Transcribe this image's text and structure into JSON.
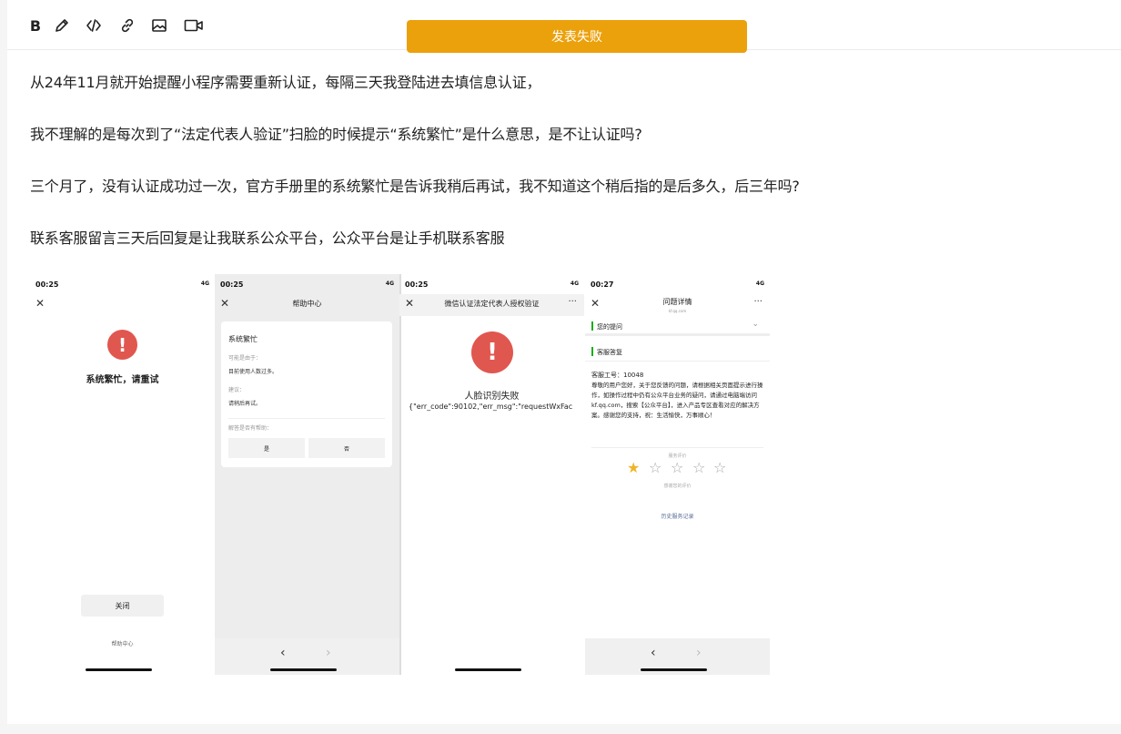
{
  "toolbar": {
    "bold_label": "B",
    "icons": [
      "pencil-icon",
      "code-icon",
      "link-icon",
      "image-icon",
      "video-icon"
    ]
  },
  "banner": {
    "text": "发表失败",
    "color": "#eba10c"
  },
  "post": {
    "paragraphs": [
      "从24年11月就开始提醒小程序需要重新认证，每隔三天我登陆进去填信息认证，",
      "我不理解的是每次到了“法定代表人验证”扫脸的时候提示“系统繁忙”是什么意思，是不让认证吗?",
      "三个月了，没有认证成功过一次，官方手册里的系统繁忙是告诉我稍后再试，我不知道这个稍后指的是后多久，后三年吗?",
      "联系客服留言三天后回复是让我联系公众平台，公众平台是让手机联系客服"
    ]
  },
  "screenshots": {
    "s1": {
      "time": "00:25",
      "signal": "4G",
      "error": "系统繁忙，请重试",
      "close": "关闭",
      "help": "帮助中心"
    },
    "s2": {
      "time": "00:25",
      "signal": "4G",
      "title": "帮助中心",
      "card_title": "系统繁忙",
      "reason_label": "可能是由于：",
      "reason": "目前使用人数过多。",
      "suggest_label": "建议：",
      "suggest": "请稍后再试。",
      "helpful": "解答是否有帮助：",
      "yes": "是",
      "no": "否"
    },
    "s3": {
      "time": "00:25",
      "signal": "4G",
      "title": "微信认证法定代表人授权验证",
      "fail": "人脸识别失败",
      "code": "{\"err_code\":90102,\"err_msg\":\"requestWxFac"
    },
    "s4": {
      "time": "00:27",
      "signal": "4G",
      "title": "问题详情",
      "subtitle": "kf.qq.com",
      "your_question": "您的提问",
      "reply_label": "客服答复",
      "agent": "客服工号：10048",
      "reply": "尊敬的用户您好，关于您反馈的问题，请根据相关页面提示进行操作，如操作过程中仍有公众平台业务的疑问，请通过电脑端访问 kf.qq.com，搜索【公众平台】，进入产品专区查看对应的解决方案。感谢您的支持，祝：生活愉快，万事顺心！",
      "rating_label": "服务评价",
      "thanks": "感谢您的评价",
      "history": "历史服务记录",
      "rating": 1,
      "rating_max": 5
    }
  }
}
